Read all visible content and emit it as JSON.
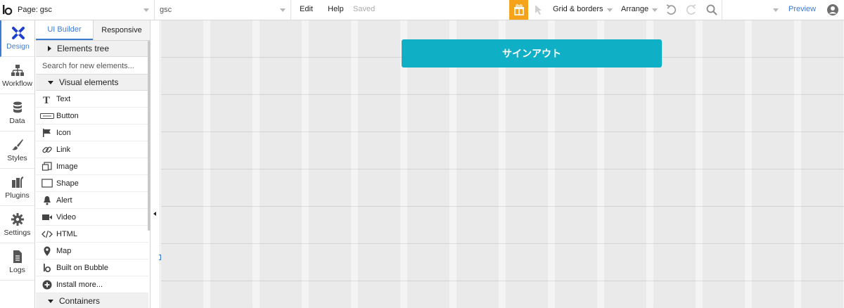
{
  "topbar": {
    "page_label": "Page: gsc",
    "element_select": "gsc",
    "menu_edit": "Edit",
    "menu_help": "Help",
    "status": "Saved",
    "grid_borders": "Grid & borders",
    "arrange": "Arrange",
    "preview": "Preview"
  },
  "leftnav": {
    "items": [
      {
        "label": "Design",
        "icon": "design-icon",
        "active": true
      },
      {
        "label": "Workflow",
        "icon": "workflow-icon"
      },
      {
        "label": "Data",
        "icon": "database-icon"
      },
      {
        "label": "Styles",
        "icon": "brush-icon"
      },
      {
        "label": "Plugins",
        "icon": "plugin-icon"
      },
      {
        "label": "Settings",
        "icon": "gear-icon"
      },
      {
        "label": "Logs",
        "icon": "document-icon"
      }
    ]
  },
  "panel": {
    "tab_ui_builder": "UI Builder",
    "tab_responsive": "Responsive",
    "elements_tree": "Elements tree",
    "search_placeholder": "Search for new elements...",
    "visual_elements": "Visual elements",
    "items": [
      {
        "label": "Text",
        "icon": "text-icon"
      },
      {
        "label": "Button",
        "icon": "button-icon"
      },
      {
        "label": "Icon",
        "icon": "flag-icon"
      },
      {
        "label": "Link",
        "icon": "link-icon"
      },
      {
        "label": "Image",
        "icon": "image-icon"
      },
      {
        "label": "Shape",
        "icon": "shape-icon"
      },
      {
        "label": "Alert",
        "icon": "bell-icon"
      },
      {
        "label": "Video",
        "icon": "video-icon"
      },
      {
        "label": "HTML",
        "icon": "code-icon"
      },
      {
        "label": "Map",
        "icon": "map-pin-icon"
      },
      {
        "label": "Built on Bubble",
        "icon": "bubble-logo-icon"
      },
      {
        "label": "Install more...",
        "icon": "plus-circle-icon"
      }
    ],
    "containers": "Containers"
  },
  "canvas": {
    "signout_button": "サインアウト"
  },
  "colors": {
    "accent": "#3c7bd4",
    "button": "#0fb0c5",
    "gift": "#f5a31a"
  }
}
